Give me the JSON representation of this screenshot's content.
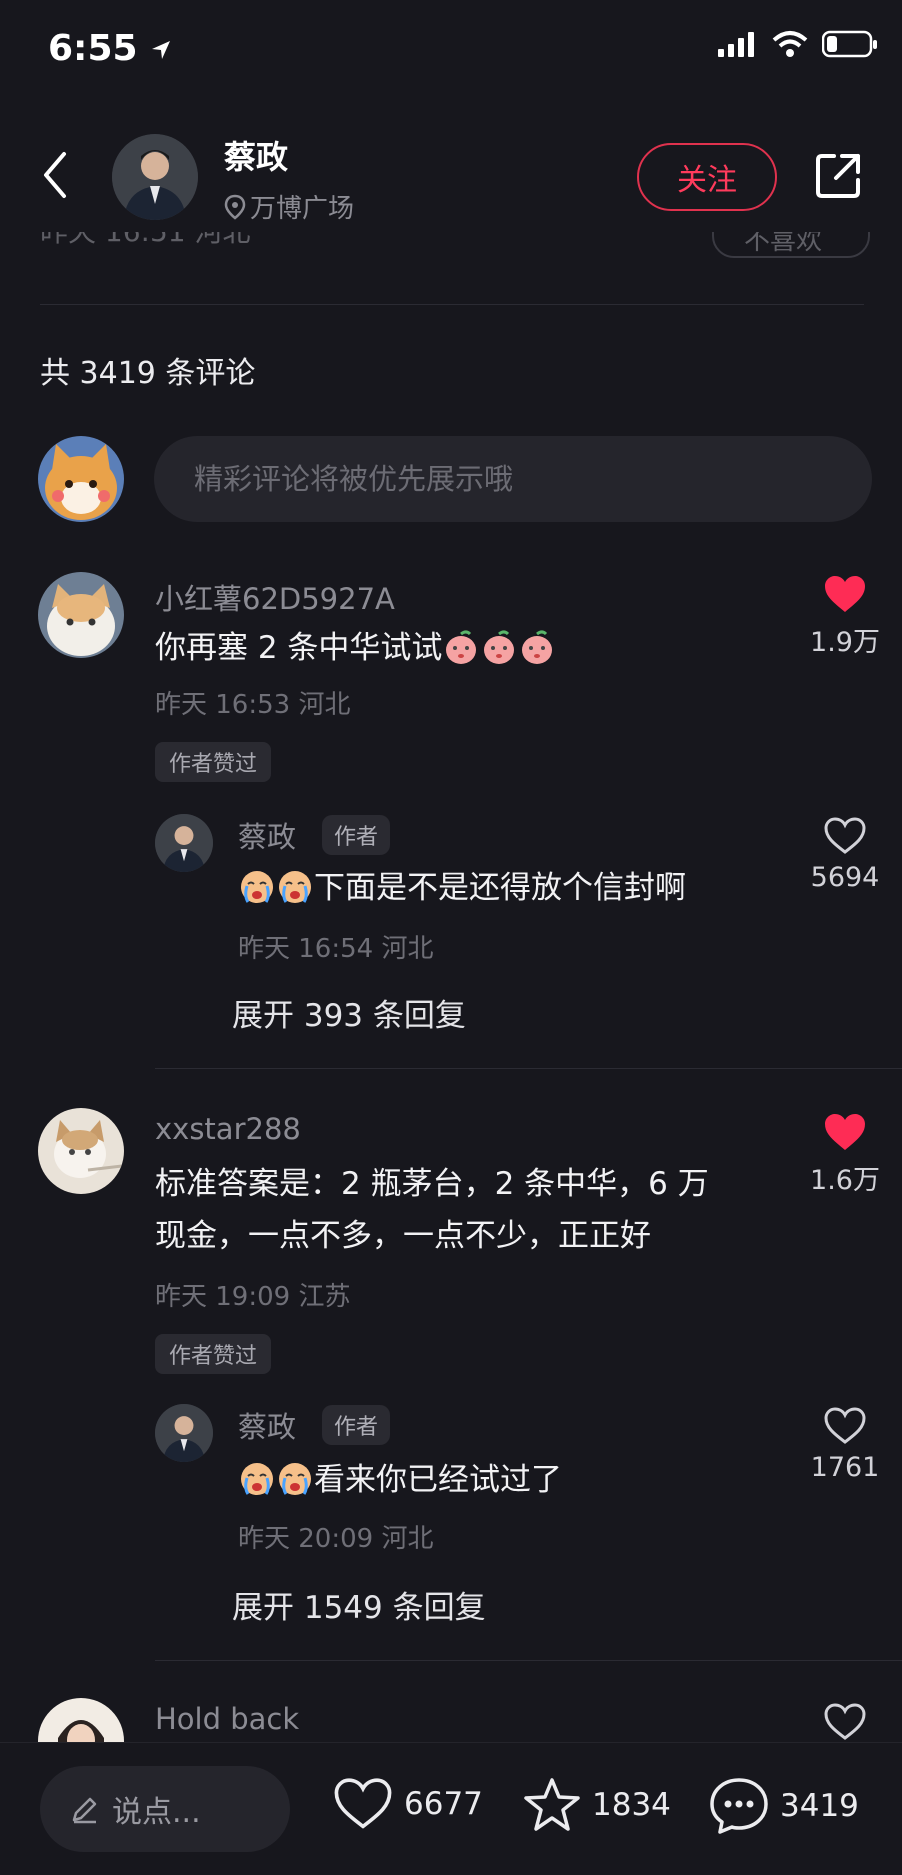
{
  "status_bar": {
    "time": "6:55"
  },
  "header": {
    "name": "蔡政",
    "location": "万博广场",
    "follow_label": "关注",
    "ghost_left": "昨天 16:51 河北",
    "ghost_right": "不喜欢"
  },
  "comments_section": {
    "total": "共 3419 条评论",
    "input_placeholder": "精彩评论将被优先展示哦"
  },
  "comments": [
    {
      "username": "小红薯62D5927A",
      "text": "你再塞 2 条中华试试",
      "meta": "昨天 16:53 河北",
      "liked_tag": "作者赞过",
      "likes": "1.9万",
      "reply": {
        "username": "蔡政",
        "author_tag": "作者",
        "text": "下面是不是还得放个信封啊",
        "meta": "昨天 16:54 河北",
        "likes": "5694"
      },
      "expand": "展开 393 条回复"
    },
    {
      "username": "xxstar288",
      "text_line1": "标准答案是：2 瓶茅台，2 条中华，6 万",
      "text_line2": "现金，一点不多，一点不少，正正好",
      "meta": "昨天 19:09 江苏",
      "liked_tag": "作者赞过",
      "likes": "1.6万",
      "reply": {
        "username": "蔡政",
        "author_tag": "作者",
        "text": "看来你已经试过了",
        "meta": "昨天 20:09 河北",
        "likes": "1761"
      },
      "expand": "展开 1549 条回复"
    },
    {
      "username": "Hold back"
    }
  ],
  "bottom_bar": {
    "say_placeholder": "说点...",
    "likes": "6677",
    "favorites": "1834",
    "comments": "3419"
  },
  "colors": {
    "background": "#17171d",
    "accent_red": "#ff3b5c",
    "like_red": "#fe2c55"
  }
}
